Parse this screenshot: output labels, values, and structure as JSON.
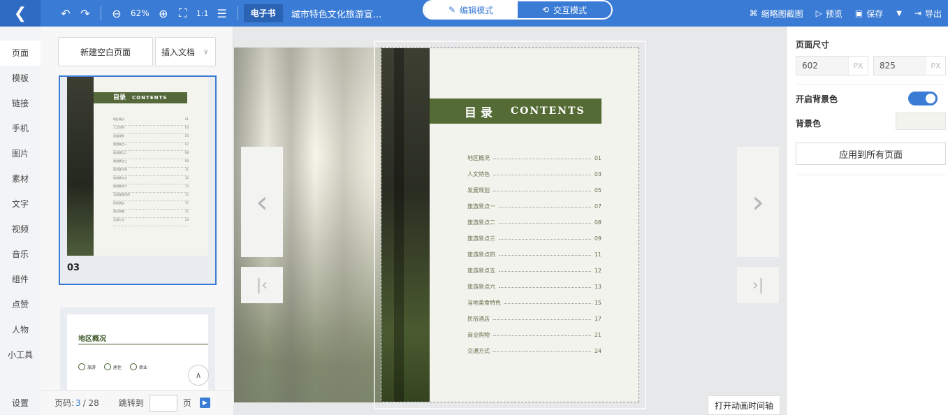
{
  "topbar": {
    "back_icon": "back-arrow-icon",
    "zoom": "62%",
    "badge": "电子书",
    "doc_title": "城市特色文化旅游宣...",
    "mode_edit": "编辑模式",
    "mode_interactive": "交互模式",
    "actions": {
      "thumbnail": "缩略图截图",
      "preview": "预览",
      "save": "保存",
      "export": "导出"
    }
  },
  "leftnav": {
    "items": [
      "页面",
      "模板",
      "链接",
      "手机",
      "图片",
      "素材",
      "文字",
      "视频",
      "音乐",
      "组件",
      "点赞",
      "人物",
      "小工具"
    ],
    "bottom": "设置"
  },
  "pagepanel": {
    "new_page": "新建空白页面",
    "insert_doc": "插入文档",
    "thumb1": {
      "band_cn": "目录",
      "band_en": "CONTENTS",
      "number": "03",
      "rows": [
        "地区概况",
        "人文特色",
        "发展规划",
        "旅游景点一",
        "旅游景点二",
        "旅游景点三",
        "旅游景点四",
        "旅游景点五",
        "旅游景点六",
        "当地美食特色",
        "民俗酒店",
        "商业购物",
        "交通方式"
      ],
      "nums": [
        "01",
        "03",
        "05",
        "07",
        "08",
        "09",
        "11",
        "12",
        "13",
        "15",
        "17",
        "21",
        "24"
      ]
    },
    "thumb2": {
      "title": "地区概况",
      "icons": [
        "旅游",
        "居住",
        "商业"
      ]
    },
    "pager": {
      "label": "页码:",
      "current": "3",
      "total": "/ 28",
      "jump": "跳转到",
      "page_unit": "页"
    }
  },
  "canvas": {
    "toc_cn": "目录",
    "toc_en": "CONTENTS",
    "toc": [
      {
        "label": "地区概况",
        "page": "01"
      },
      {
        "label": "人文特色",
        "page": "03"
      },
      {
        "label": "发展规划",
        "page": "05"
      },
      {
        "label": "旅游景点一",
        "page": "07"
      },
      {
        "label": "旅游景点二",
        "page": "08"
      },
      {
        "label": "旅游景点三",
        "page": "09"
      },
      {
        "label": "旅游景点四",
        "page": "11"
      },
      {
        "label": "旅游景点五",
        "page": "12"
      },
      {
        "label": "旅游景点六",
        "page": "13"
      },
      {
        "label": "当地美食特色",
        "page": "15"
      },
      {
        "label": "民俗酒店",
        "page": "17"
      },
      {
        "label": "商业购物",
        "page": "21"
      },
      {
        "label": "交通方式",
        "page": "24"
      }
    ],
    "anim_button": "打开动画时间轴"
  },
  "rightpanel": {
    "page_size": "页面尺寸",
    "width": "602",
    "height": "825",
    "unit": "PX",
    "bg_enable": "开启背景色",
    "bg_color_label": "背景色",
    "apply_all": "应用到所有页面"
  },
  "colors": {
    "accent": "#3a7bd5",
    "toc_band": "#556b35"
  }
}
